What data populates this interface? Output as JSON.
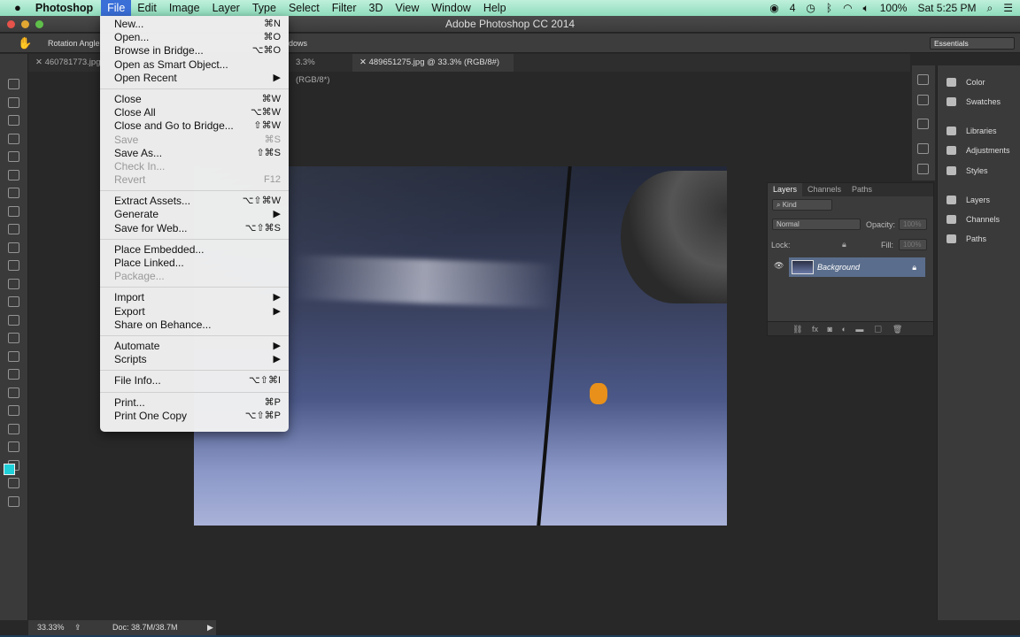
{
  "menubar": {
    "app": "Photoshop",
    "items": [
      "File",
      "Edit",
      "Image",
      "Layer",
      "Type",
      "Select",
      "Filter",
      "3D",
      "View",
      "Window",
      "Help"
    ],
    "status": {
      "adobe_count": "4",
      "battery": "100%",
      "clock": "Sat 5:25 PM"
    }
  },
  "window": {
    "title": "Adobe Photoshop CC 2014"
  },
  "options": {
    "rotation_label": "Rotation Angle",
    "all_windows": "dows",
    "workspace": "Essentials"
  },
  "tabs": [
    {
      "label": "460781773.jpg"
    },
    {
      "label": "3.3% (RGB/8*)"
    },
    {
      "label": "489651275.jpg @ 33.3% (RGB/8#)"
    }
  ],
  "file_menu": {
    "groups": [
      [
        {
          "label": "New...",
          "sc": "⌘N"
        },
        {
          "label": "Open...",
          "sc": "⌘O"
        },
        {
          "label": "Browse in Bridge...",
          "sc": "⌥⌘O"
        },
        {
          "label": "Open as Smart Object...",
          "sc": ""
        },
        {
          "label": "Open Recent",
          "sc": "▶"
        }
      ],
      [
        {
          "label": "Close",
          "sc": "⌘W"
        },
        {
          "label": "Close All",
          "sc": "⌥⌘W"
        },
        {
          "label": "Close and Go to Bridge...",
          "sc": "⇧⌘W"
        },
        {
          "label": "Save",
          "sc": "⌘S",
          "disabled": true
        },
        {
          "label": "Save As...",
          "sc": "⇧⌘S"
        },
        {
          "label": "Check In...",
          "sc": "",
          "disabled": true
        },
        {
          "label": "Revert",
          "sc": "F12",
          "disabled": true
        }
      ],
      [
        {
          "label": "Extract Assets...",
          "sc": "⌥⇧⌘W"
        },
        {
          "label": "Generate",
          "sc": "▶"
        },
        {
          "label": "Save for Web...",
          "sc": "⌥⇧⌘S"
        }
      ],
      [
        {
          "label": "Place Embedded...",
          "sc": ""
        },
        {
          "label": "Place Linked...",
          "sc": ""
        },
        {
          "label": "Package...",
          "sc": "",
          "disabled": true
        }
      ],
      [
        {
          "label": "Import",
          "sc": "▶"
        },
        {
          "label": "Export",
          "sc": "▶"
        },
        {
          "label": "Share on Behance...",
          "sc": ""
        }
      ],
      [
        {
          "label": "Automate",
          "sc": "▶"
        },
        {
          "label": "Scripts",
          "sc": "▶"
        }
      ],
      [
        {
          "label": "File Info...",
          "sc": "⌥⇧⌘I"
        }
      ],
      [
        {
          "label": "Print...",
          "sc": "⌘P"
        },
        {
          "label": "Print One Copy",
          "sc": "⌥⇧⌘P"
        }
      ]
    ]
  },
  "layers_panel": {
    "tabs": [
      "Layers",
      "Channels",
      "Paths"
    ],
    "filter": "Kind",
    "blend": "Normal",
    "opacity_label": "Opacity:",
    "opacity": "100%",
    "lock_label": "Lock:",
    "fill_label": "Fill:",
    "fill": "100%",
    "layer_name": "Background"
  },
  "side_panel": [
    "Color",
    "Swatches",
    "Libraries",
    "Adjustments",
    "Styles",
    "Layers",
    "Channels",
    "Paths"
  ],
  "status": {
    "zoom": "33.33%",
    "doc": "Doc: 38.7M/38.7M"
  }
}
